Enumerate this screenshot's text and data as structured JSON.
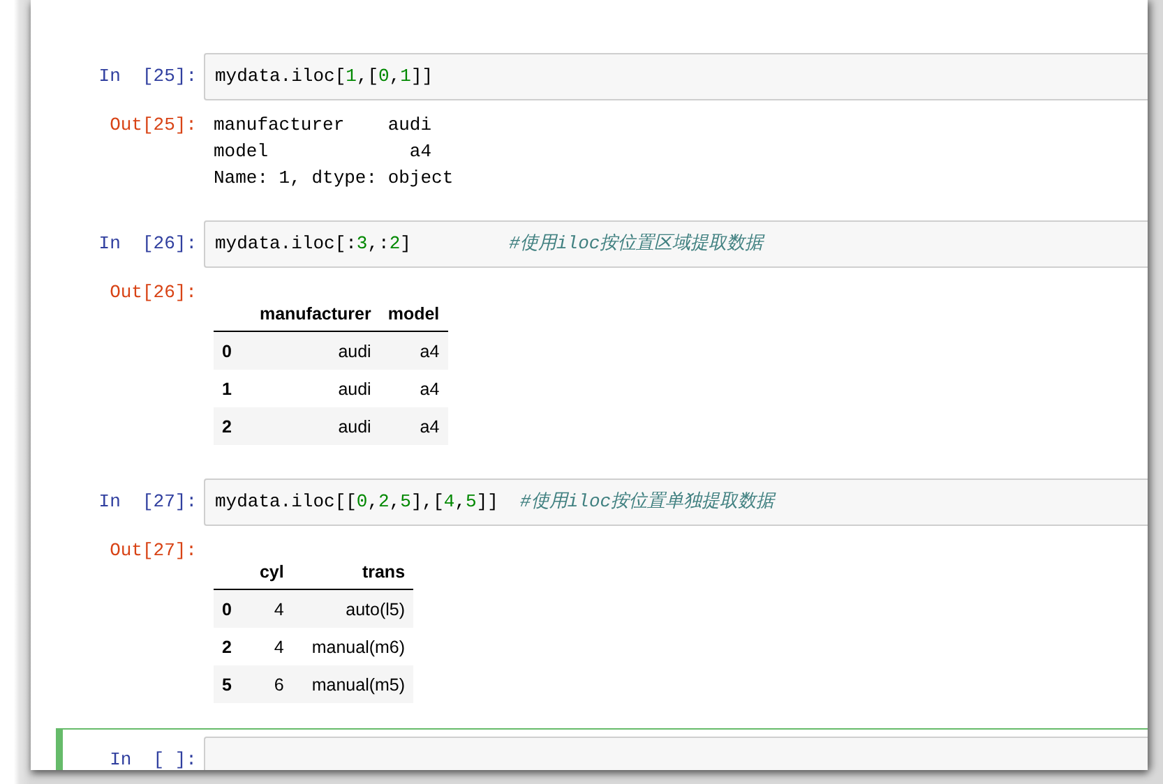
{
  "cells": [
    {
      "selected": false,
      "prompt": "In  [25]:",
      "code": [
        {
          "kind": "plain",
          "text": "mydata.iloc["
        },
        {
          "kind": "number",
          "text": "1"
        },
        {
          "kind": "plain",
          "text": ",["
        },
        {
          "kind": "number",
          "text": "0"
        },
        {
          "kind": "plain",
          "text": ","
        },
        {
          "kind": "number",
          "text": "1"
        },
        {
          "kind": "plain",
          "text": "]]"
        }
      ],
      "output": {
        "prompt": "Out[25]:",
        "kind": "text",
        "lines": [
          "manufacturer    audi",
          "model             a4",
          "Name: 1, dtype: object"
        ]
      }
    },
    {
      "selected": false,
      "prompt": "In  [26]:",
      "code": [
        {
          "kind": "plain",
          "text": "mydata.iloc[:"
        },
        {
          "kind": "number",
          "text": "3"
        },
        {
          "kind": "plain",
          "text": ",:"
        },
        {
          "kind": "number",
          "text": "2"
        },
        {
          "kind": "plain",
          "text": "]         "
        },
        {
          "kind": "comment",
          "text": "#使用iloc按位置区域提取数据"
        }
      ],
      "output": {
        "prompt": "Out[26]:",
        "kind": "table",
        "columns": [
          "manufacturer",
          "model"
        ],
        "rows": [
          {
            "index": "0",
            "cells": [
              "audi",
              "a4"
            ]
          },
          {
            "index": "1",
            "cells": [
              "audi",
              "a4"
            ]
          },
          {
            "index": "2",
            "cells": [
              "audi",
              "a4"
            ]
          }
        ]
      }
    },
    {
      "selected": false,
      "prompt": "In  [27]:",
      "code": [
        {
          "kind": "plain",
          "text": "mydata.iloc[["
        },
        {
          "kind": "number",
          "text": "0"
        },
        {
          "kind": "plain",
          "text": ","
        },
        {
          "kind": "number",
          "text": "2"
        },
        {
          "kind": "plain",
          "text": ","
        },
        {
          "kind": "number",
          "text": "5"
        },
        {
          "kind": "plain",
          "text": "],["
        },
        {
          "kind": "number",
          "text": "4"
        },
        {
          "kind": "plain",
          "text": ","
        },
        {
          "kind": "number",
          "text": "5"
        },
        {
          "kind": "plain",
          "text": "]]  "
        },
        {
          "kind": "comment",
          "text": "#使用iloc按位置单独提取数据"
        }
      ],
      "output": {
        "prompt": "Out[27]:",
        "kind": "table",
        "columns": [
          "cyl",
          "trans"
        ],
        "rows": [
          {
            "index": "0",
            "cells": [
              "4",
              "auto(l5)"
            ]
          },
          {
            "index": "2",
            "cells": [
              "4",
              "manual(m6)"
            ]
          },
          {
            "index": "5",
            "cells": [
              "6",
              "manual(m5)"
            ]
          }
        ]
      }
    },
    {
      "selected": true,
      "prompt": "In  [ ]:"
    }
  ]
}
